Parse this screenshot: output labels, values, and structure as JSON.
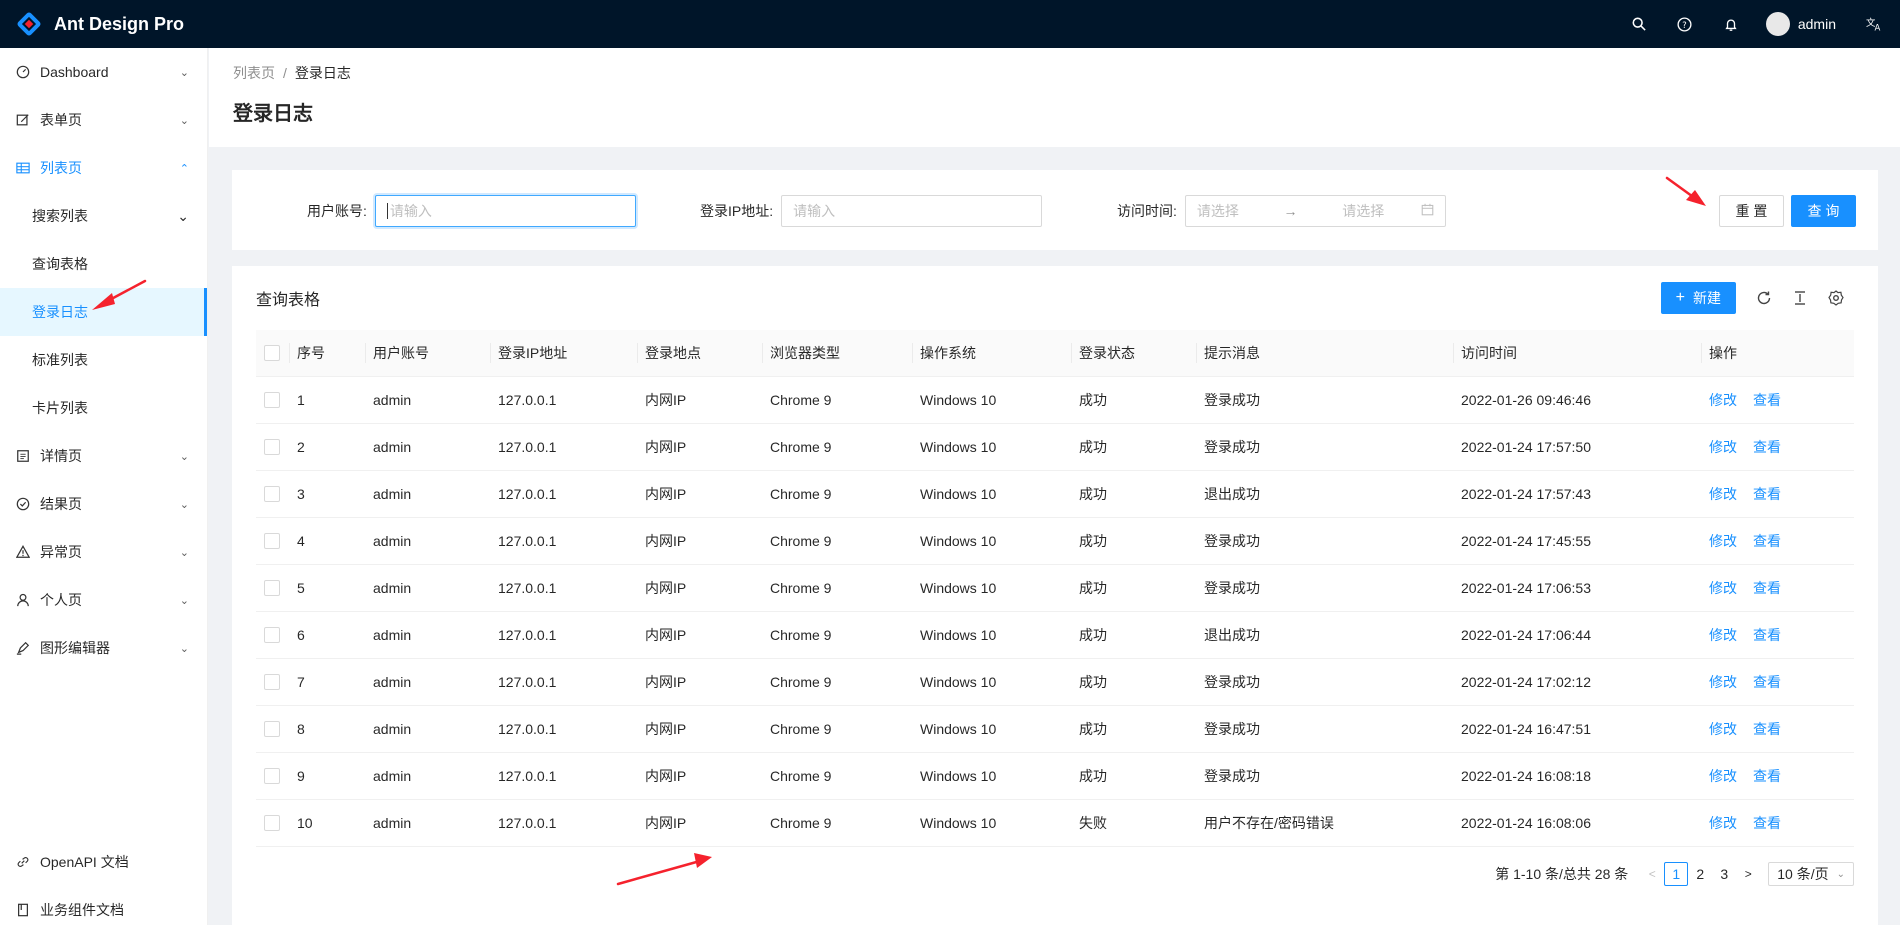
{
  "app": {
    "title": "Ant Design Pro"
  },
  "header": {
    "user_name": "admin",
    "icons": [
      "search-icon",
      "question-icon",
      "bell-icon",
      "translate-icon"
    ]
  },
  "sidebar": {
    "items": [
      {
        "label": "Dashboard",
        "icon": "dashboard-icon"
      },
      {
        "label": "表单页",
        "icon": "form-icon"
      },
      {
        "label": "列表页",
        "icon": "table-icon"
      }
    ],
    "sub_items": [
      {
        "label": "搜索列表"
      },
      {
        "label": "查询表格"
      },
      {
        "label": "登录日志"
      },
      {
        "label": "标准列表"
      },
      {
        "label": "卡片列表"
      }
    ],
    "items_after": [
      {
        "label": "详情页",
        "icon": "profile-icon"
      },
      {
        "label": "结果页",
        "icon": "check-circle-icon"
      },
      {
        "label": "异常页",
        "icon": "warning-icon"
      },
      {
        "label": "个人页",
        "icon": "user-icon"
      },
      {
        "label": "图形编辑器",
        "icon": "highlight-icon"
      }
    ],
    "bottom_items": [
      {
        "label": "OpenAPI 文档",
        "icon": "link-icon"
      },
      {
        "label": "业务组件文档",
        "icon": "book-icon"
      }
    ]
  },
  "page": {
    "breadcrumb": [
      "列表页",
      "登录日志"
    ],
    "breadcrumb_sep": "/",
    "title": "登录日志"
  },
  "search": {
    "account_label": "用户账号:",
    "account_placeholder": "请输入",
    "ip_label": "登录IP地址:",
    "ip_placeholder": "请输入",
    "time_label": "访问时间:",
    "time_start_placeholder": "请选择",
    "time_end_placeholder": "请选择",
    "time_arrow": "→",
    "reset_label": "重 置",
    "submit_label": "查 询"
  },
  "table": {
    "title": "查询表格",
    "new_label": "新建",
    "columns": [
      "序号",
      "用户账号",
      "登录IP地址",
      "登录地点",
      "浏览器类型",
      "操作系统",
      "登录状态",
      "提示消息",
      "访问时间",
      "操作"
    ],
    "edit_label": "修改",
    "view_label": "查看",
    "rows": [
      [
        "1",
        "admin",
        "127.0.0.1",
        "内网IP",
        "Chrome 9",
        "Windows 10",
        "成功",
        "登录成功",
        "2022-01-26 09:46:46"
      ],
      [
        "2",
        "admin",
        "127.0.0.1",
        "内网IP",
        "Chrome 9",
        "Windows 10",
        "成功",
        "登录成功",
        "2022-01-24 17:57:50"
      ],
      [
        "3",
        "admin",
        "127.0.0.1",
        "内网IP",
        "Chrome 9",
        "Windows 10",
        "成功",
        "退出成功",
        "2022-01-24 17:57:43"
      ],
      [
        "4",
        "admin",
        "127.0.0.1",
        "内网IP",
        "Chrome 9",
        "Windows 10",
        "成功",
        "登录成功",
        "2022-01-24 17:45:55"
      ],
      [
        "5",
        "admin",
        "127.0.0.1",
        "内网IP",
        "Chrome 9",
        "Windows 10",
        "成功",
        "登录成功",
        "2022-01-24 17:06:53"
      ],
      [
        "6",
        "admin",
        "127.0.0.1",
        "内网IP",
        "Chrome 9",
        "Windows 10",
        "成功",
        "退出成功",
        "2022-01-24 17:06:44"
      ],
      [
        "7",
        "admin",
        "127.0.0.1",
        "内网IP",
        "Chrome 9",
        "Windows 10",
        "成功",
        "登录成功",
        "2022-01-24 17:02:12"
      ],
      [
        "8",
        "admin",
        "127.0.0.1",
        "内网IP",
        "Chrome 9",
        "Windows 10",
        "成功",
        "登录成功",
        "2022-01-24 16:47:51"
      ],
      [
        "9",
        "admin",
        "127.0.0.1",
        "内网IP",
        "Chrome 9",
        "Windows 10",
        "成功",
        "登录成功",
        "2022-01-24 16:08:18"
      ],
      [
        "10",
        "admin",
        "127.0.0.1",
        "内网IP",
        "Chrome 9",
        "Windows 10",
        "失败",
        "用户不存在/密码错误",
        "2022-01-24 16:08:06"
      ]
    ]
  },
  "pagination": {
    "total_text": "第 1-10 条/总共 28 条",
    "pages": [
      "1",
      "2",
      "3"
    ],
    "current": "1",
    "page_size": "10 条/页"
  },
  "colors": {
    "primary": "#1890ff",
    "header_bg": "#001529",
    "annotation": "#f5222d"
  }
}
